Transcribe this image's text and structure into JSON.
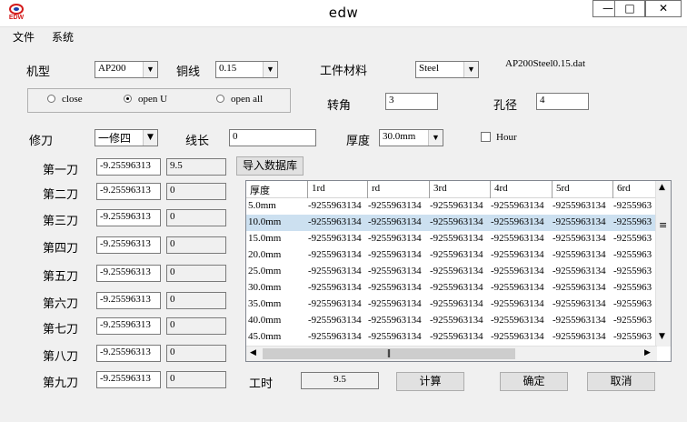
{
  "window": {
    "title": "edw",
    "logo_text": "EDW",
    "min_label": "—",
    "max_label": "□",
    "close_label": "✕"
  },
  "menu": [
    "文件",
    "系统"
  ],
  "machine": {
    "label": "机型",
    "value": "AP200"
  },
  "wire": {
    "label": "铜线",
    "value": "0.15"
  },
  "material": {
    "label": "工件材料",
    "value": "Steel"
  },
  "file_name": "AP200Steel0.15.dat",
  "mode": {
    "options": [
      "close",
      "open U",
      "open all"
    ],
    "selected": "open U"
  },
  "angle": {
    "label": "转角",
    "value": "3"
  },
  "hole": {
    "label": "孔径",
    "value": "4"
  },
  "trim": {
    "label": "修刀",
    "value": "一修四"
  },
  "line_length": {
    "label": "线长",
    "value": "0"
  },
  "thickness": {
    "label": "厚度",
    "value": "30.0mm"
  },
  "hour": {
    "label": "Hour",
    "checked": false
  },
  "cuts": [
    {
      "label": "第一刀",
      "value": "-9.25596313",
      "extra": "9.5"
    },
    {
      "label": "第二刀",
      "value": "-9.25596313",
      "extra": "0"
    },
    {
      "label": "第三刀",
      "value": "-9.25596313",
      "extra": "0"
    },
    {
      "label": "第四刀",
      "value": "-9.25596313",
      "extra": "0"
    },
    {
      "label": "第五刀",
      "value": "-9.25596313",
      "extra": "0"
    },
    {
      "label": "第六刀",
      "value": "-9.25596313",
      "extra": "0"
    },
    {
      "label": "第七刀",
      "value": "-9.25596313",
      "extra": "0"
    },
    {
      "label": "第八刀",
      "value": "-9.25596313",
      "extra": "0"
    },
    {
      "label": "第九刀",
      "value": "-9.25596313",
      "extra": "0"
    }
  ],
  "import_button": "导入数据库",
  "table": {
    "columns": [
      "厚度",
      "1rd",
      "rd",
      "3rd",
      "4rd",
      "5rd",
      "6rd"
    ],
    "rows": [
      [
        "5.0mm",
        "-9255963134",
        "-9255963134",
        "-9255963134",
        "-9255963134",
        "-9255963134",
        "-9255963"
      ],
      [
        "10.0mm",
        "-9255963134",
        "-9255963134",
        "-9255963134",
        "-9255963134",
        "-9255963134",
        "-9255963"
      ],
      [
        "15.0mm",
        "-9255963134",
        "-9255963134",
        "-9255963134",
        "-9255963134",
        "-9255963134",
        "-9255963"
      ],
      [
        "20.0mm",
        "-9255963134",
        "-9255963134",
        "-9255963134",
        "-9255963134",
        "-9255963134",
        "-9255963"
      ],
      [
        "25.0mm",
        "-9255963134",
        "-9255963134",
        "-9255963134",
        "-9255963134",
        "-9255963134",
        "-9255963"
      ],
      [
        "30.0mm",
        "-9255963134",
        "-9255963134",
        "-9255963134",
        "-9255963134",
        "-9255963134",
        "-9255963"
      ],
      [
        "35.0mm",
        "-9255963134",
        "-9255963134",
        "-9255963134",
        "-9255963134",
        "-9255963134",
        "-9255963"
      ],
      [
        "40.0mm",
        "-9255963134",
        "-9255963134",
        "-9255963134",
        "-9255963134",
        "-9255963134",
        "-9255963"
      ],
      [
        "45.0mm",
        "-9255963134",
        "-9255963134",
        "-9255963134",
        "-9255963134",
        "-9255963134",
        "-9255963"
      ]
    ],
    "selected_row": 1
  },
  "worktime": {
    "label": "工时",
    "value": "9.5"
  },
  "buttons": {
    "calc": "计算",
    "ok": "确定",
    "cancel": "取消"
  },
  "icons": {
    "scroll_up": "▲",
    "scroll_down": "▼",
    "scroll_left": "◀",
    "scroll_right": "▶",
    "scroll_thumb": "≡",
    "hscroll_thumb": "‖",
    "dropdown": "▼"
  },
  "colors": {
    "selected_row": "#cce0f0",
    "logo_red": "#d41b1b",
    "logo_blue": "#1b3fa8"
  }
}
